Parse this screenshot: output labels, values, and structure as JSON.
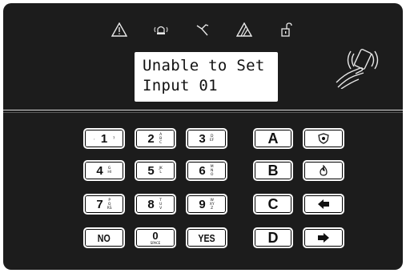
{
  "indicators": [
    {
      "name": "alarm-triangle-icon"
    },
    {
      "name": "siren-icon"
    },
    {
      "name": "tamper-tool-icon"
    },
    {
      "name": "fault-triangle-icon"
    },
    {
      "name": "unlock-padlock-icon"
    }
  ],
  "display": {
    "line1": "Unable to Set",
    "line2": "Input 01"
  },
  "keypad": {
    "key1": {
      "label": "1",
      "sub": ""
    },
    "key2": {
      "label": "2",
      "sub": "ABC"
    },
    "key3": {
      "label": "3",
      "sub": "DEF"
    },
    "key4": {
      "label": "4",
      "sub": "GHI"
    },
    "key5": {
      "label": "5",
      "sub": "JKL"
    },
    "key6": {
      "label": "6",
      "sub": "MNO"
    },
    "key7": {
      "label": "7",
      "sub": "PQRS"
    },
    "key8": {
      "label": "8",
      "sub": "TUV"
    },
    "key9": {
      "label": "9",
      "sub": "WXYZ"
    },
    "key0": {
      "label": "0",
      "sub": "SPACE"
    },
    "no": "NO",
    "yes": "YES",
    "A": "A",
    "B": "B",
    "C": "C",
    "D": "D"
  },
  "colors": {
    "panel": "#1c1c1c",
    "key": "#ffffff",
    "text": "#111111"
  }
}
